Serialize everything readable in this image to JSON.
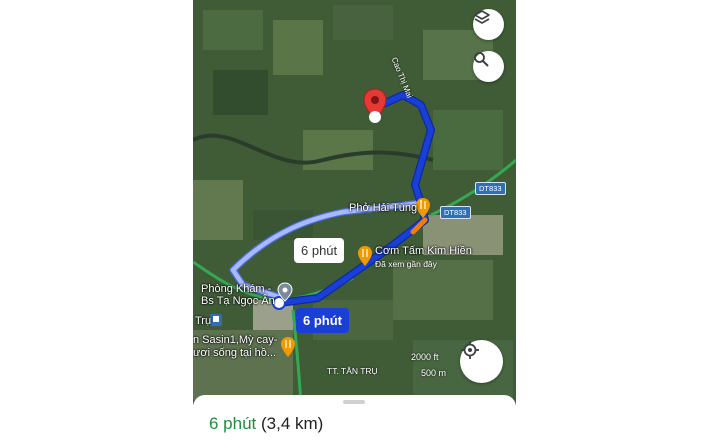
{
  "map": {
    "places": [
      {
        "name": "Phở Hải Tùng"
      },
      {
        "name": "Cơm Tấm Kim Hiền",
        "subtitle": "Đã xem gần đây"
      },
      {
        "name_line1": "Phòng Khám -",
        "name_line2": "Bs Tạ Ngọc Ân"
      },
      {
        "name_line1": "n Sasin1,Mỳ cay-",
        "name_line2": "ươi sống tại hồ..."
      }
    ],
    "road_labels": {
      "cao_thi_mai": "Cao Thị Mai",
      "dt833_a": "DT833",
      "dt833_b": "DT833"
    },
    "area_labels": {
      "tan_tru_left": "Trụ",
      "tt_tan_tru": "TT. TÂN TRỤ"
    },
    "route_bubbles": {
      "alternate": "6 phút",
      "selected": "6 phút"
    },
    "scale": {
      "ft": "2000 ft",
      "m": "500 m"
    },
    "icons": {
      "layers": "layers-icon",
      "search": "search-icon",
      "my_location": "my-location-icon",
      "destination": "destination-pin-icon",
      "restaurant": "restaurant-icon",
      "clinic": "clinic-icon"
    },
    "colors": {
      "route_primary": "#1a3fd6",
      "route_alternate": "#a9b8ff",
      "destination_pin": "#e53935",
      "restaurant_pin": "#f29900",
      "traffic_orange": "#f57c00",
      "road_green": "#34a853"
    }
  },
  "route_summary": {
    "duration": "6 phút",
    "distance": "(3,4 km)"
  }
}
